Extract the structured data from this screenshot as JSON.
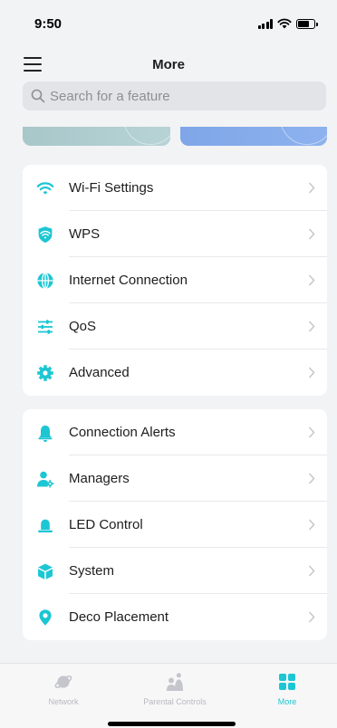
{
  "status_bar": {
    "time": "9:50"
  },
  "nav": {
    "title": "More"
  },
  "search": {
    "placeholder": "Search for a feature"
  },
  "accent_color": "#1cc6d3",
  "groups": [
    {
      "items": [
        {
          "label": "Wi-Fi Settings",
          "icon": "wifi-icon"
        },
        {
          "label": "WPS",
          "icon": "wps-shield-icon"
        },
        {
          "label": "Internet Connection",
          "icon": "globe-icon"
        },
        {
          "label": "QoS",
          "icon": "sliders-icon"
        },
        {
          "label": "Advanced",
          "icon": "gear-icon"
        }
      ]
    },
    {
      "items": [
        {
          "label": "Connection Alerts",
          "icon": "bell-icon"
        },
        {
          "label": "Managers",
          "icon": "user-gear-icon"
        },
        {
          "label": "LED Control",
          "icon": "led-icon"
        },
        {
          "label": "System",
          "icon": "cube-icon"
        },
        {
          "label": "Deco Placement",
          "icon": "location-pin-icon"
        }
      ]
    }
  ],
  "tab_bar": {
    "tabs": [
      {
        "label": "Network",
        "icon": "planet-icon",
        "active": false
      },
      {
        "label": "Parental Controls",
        "icon": "family-icon",
        "active": false
      },
      {
        "label": "More",
        "icon": "grid-icon",
        "active": true
      }
    ]
  }
}
